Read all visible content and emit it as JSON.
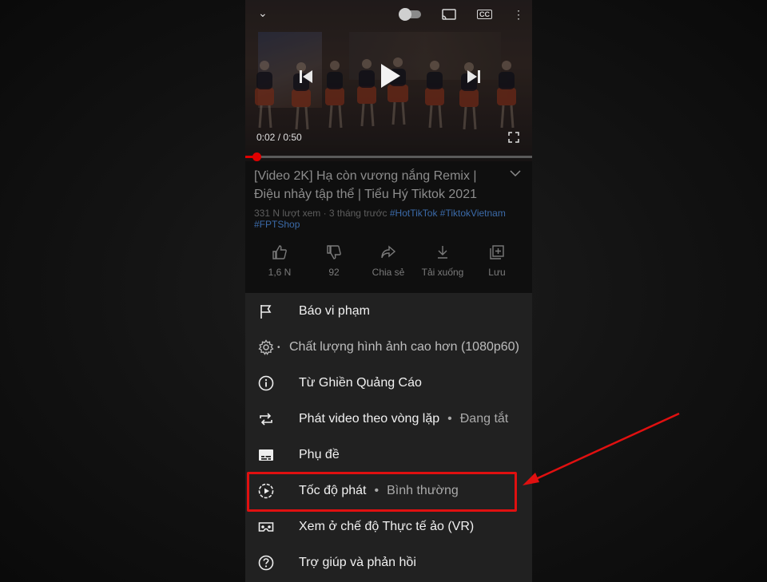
{
  "player": {
    "time_current": "0:02",
    "time_total": "0:50",
    "time_display": "0:02 / 0:50",
    "progress_fraction": 0.04,
    "accent_color": "#e00000"
  },
  "video": {
    "title": "[Video 2K] Hạ còn vương nắng Remix | Điệu nhảy tập thể | Tiểu Hý Tiktok 2021",
    "views_age": "331 N lượt xem · 3 tháng trước",
    "hashtags": [
      "#HotTikTok",
      "#TiktokVietnam",
      "#FPTShop"
    ]
  },
  "actions": [
    {
      "label": "1,6 N",
      "icon": "thumbs-up-icon"
    },
    {
      "label": "92",
      "icon": "thumbs-down-icon"
    },
    {
      "label": "Chia sẻ",
      "icon": "share-icon"
    },
    {
      "label": "Tải xuống",
      "icon": "download-icon"
    },
    {
      "label": "Lưu",
      "icon": "add-to-playlist-icon"
    }
  ],
  "menu": {
    "items": [
      {
        "label": "Báo vi phạm",
        "icon": "flag-icon"
      },
      {
        "label": "Chất lượng hình ảnh cao hơn (1080p60)",
        "icon": "settings-gear-icon"
      },
      {
        "label": "Từ Ghiền Quảng Cáo",
        "icon": "info-icon"
      },
      {
        "label": "Phát video theo vòng lặp",
        "value": "Đang tắt",
        "icon": "loop-icon"
      },
      {
        "label": "Phụ đề",
        "icon": "captions-icon"
      },
      {
        "label": "Tốc độ phát",
        "value": "Bình thường",
        "icon": "playback-speed-icon"
      },
      {
        "label": "Xem ở chế độ Thực tế ảo (VR)",
        "icon": "vr-headset-icon"
      },
      {
        "label": "Trợ giúp và phản hồi",
        "icon": "help-icon"
      }
    ]
  },
  "annotation": {
    "highlight_color": "#e01010",
    "highlighted_item": "Tốc độ phát"
  }
}
